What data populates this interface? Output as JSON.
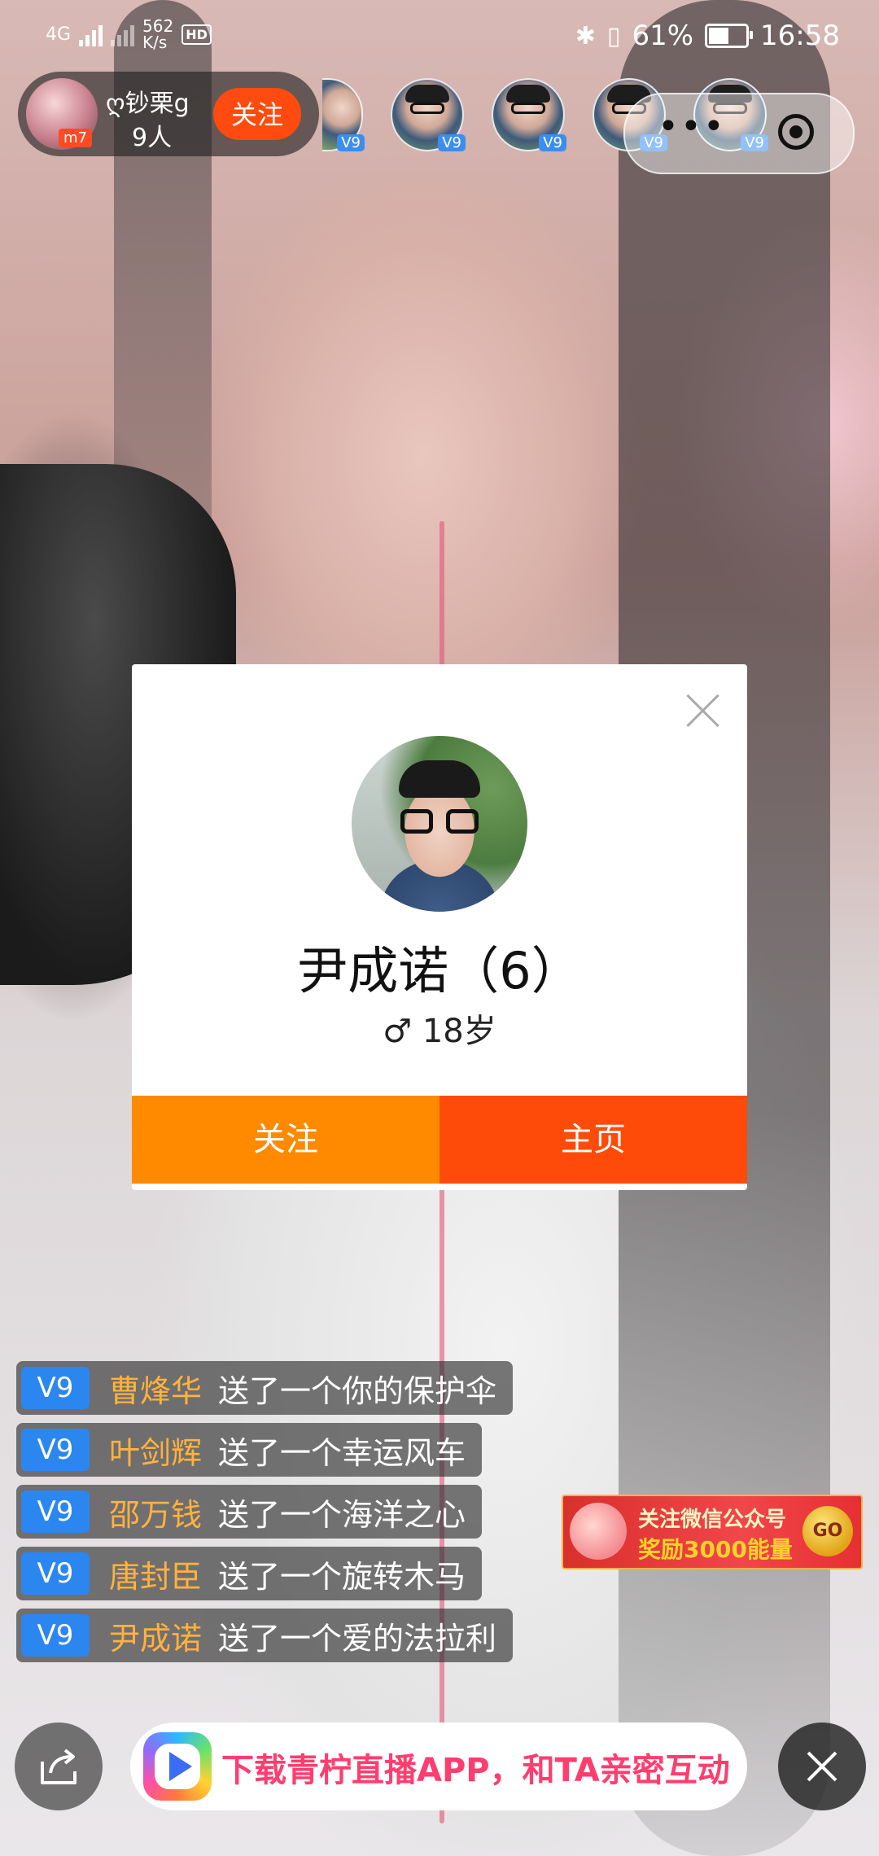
{
  "status_bar": {
    "network": "4G",
    "net_speed": "562",
    "net_speed_unit": "K/s",
    "hd_label": "HD",
    "battery_percent": "61%",
    "battery_level": 0.61,
    "time": "16:58"
  },
  "host": {
    "name": "ღ钞栗ց",
    "viewer_count": "9人",
    "level_badge": "m7",
    "follow_label": "关注"
  },
  "viewers": [
    {
      "badge": "V9"
    },
    {
      "badge": "V9"
    },
    {
      "badge": "V9"
    },
    {
      "badge": "V9"
    },
    {
      "badge": "V9"
    },
    {
      "badge": "V9"
    }
  ],
  "capsule": {
    "more_label": "•••"
  },
  "profile_card": {
    "name": "尹成诺（6）",
    "gender_symbol": "♂",
    "age": "18岁",
    "follow_label": "关注",
    "home_label": "主页"
  },
  "gift_messages": [
    {
      "level": "V9",
      "user": "曹烽华",
      "text": "送了一个你的保护伞"
    },
    {
      "level": "V9",
      "user": "叶剑辉",
      "text": "送了一个幸运风车"
    },
    {
      "level": "V9",
      "user": "邵万钱",
      "text": "送了一个海洋之心"
    },
    {
      "level": "V9",
      "user": "唐封臣",
      "text": "送了一个旋转木马"
    },
    {
      "level": "V9",
      "user": "尹成诺",
      "text": "送了一个爱的法拉利"
    }
  ],
  "promo": {
    "line1": "关注微信公众号",
    "line2": "奖励3000能量",
    "go": "GO"
  },
  "download_bar": {
    "text": "下载青柠直播APP，和TA亲密互动"
  },
  "colors": {
    "follow_orange": "#ff8a00",
    "home_red": "#ff4b0a",
    "level_blue": "#2c86f0",
    "username_gold": "#ffb23e",
    "download_pink": "#ff3d6e"
  }
}
